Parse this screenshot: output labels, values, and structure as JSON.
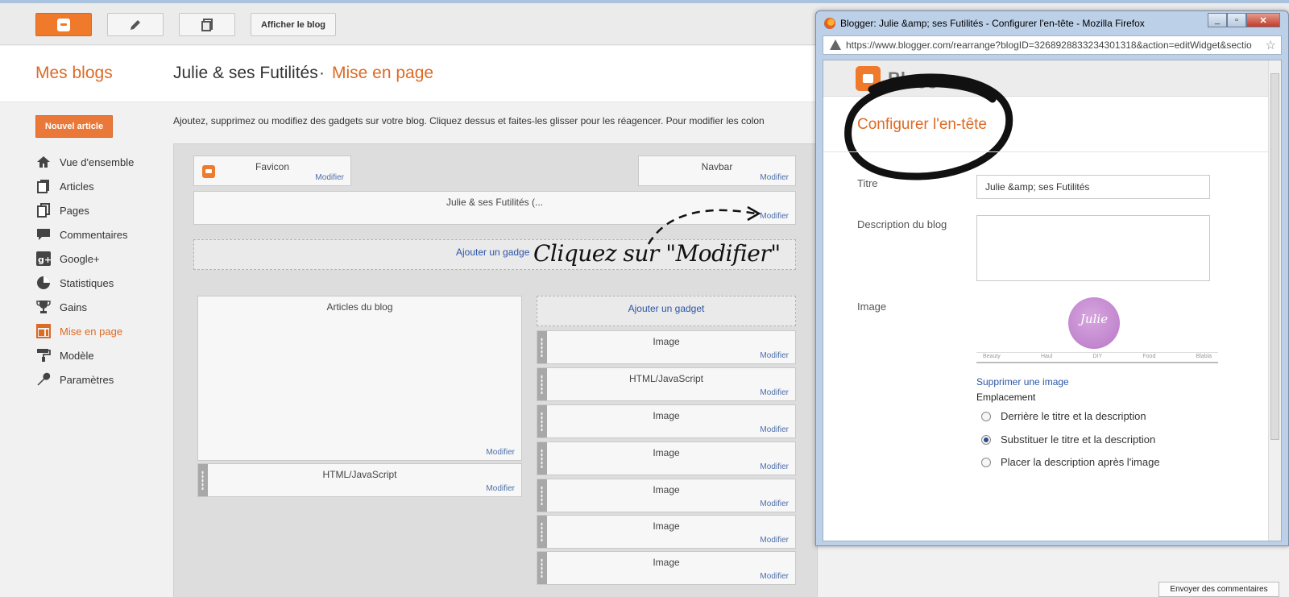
{
  "topbar": {
    "view_blog": "Afficher le blog"
  },
  "header": {
    "my_blogs": "Mes blogs",
    "blog_title": "Julie & ses Futilités",
    "separator": "·",
    "page": "Mise en page"
  },
  "sidebar": {
    "new_article": "Nouvel article",
    "items": [
      {
        "label": "Vue d'ensemble",
        "icon": "home-icon"
      },
      {
        "label": "Articles",
        "icon": "articles-icon"
      },
      {
        "label": "Pages",
        "icon": "pages-icon"
      },
      {
        "label": "Commentaires",
        "icon": "comments-icon"
      },
      {
        "label": "Google+",
        "icon": "googleplus-icon"
      },
      {
        "label": "Statistiques",
        "icon": "stats-icon"
      },
      {
        "label": "Gains",
        "icon": "trophy-icon"
      },
      {
        "label": "Mise en page",
        "icon": "layout-icon"
      },
      {
        "label": "Modèle",
        "icon": "paint-roller-icon"
      },
      {
        "label": "Paramètres",
        "icon": "wrench-icon"
      }
    ]
  },
  "main": {
    "description": "Ajoutez, supprimez ou modifiez des gadgets sur votre blog. Cliquez dessus et faites-les glisser pour les réagencer. Pour modifier les colon",
    "edit_label": "Modifier",
    "add_gadget": "Ajouter un gadget",
    "add_gadget_truncated": "Ajouter un gadge",
    "widgets": {
      "favicon": "Favicon",
      "navbar": "Navbar",
      "header": "Julie & ses Futilités (...",
      "blog_posts": "Articles du blog",
      "html_js": "HTML/JavaScript",
      "image": "Image"
    },
    "annotation": "Cliquez sur \"Modifier\""
  },
  "popup": {
    "window_title": "Blogger: Julie &amp; ses Futilités - Configurer l'en-tête - Mozilla Firefox",
    "url": "https://www.blogger.com/rearrange?blogID=3268928833234301318&action=editWidget&sectio",
    "brand": "Blogger",
    "heading": "Configurer l'en-tête",
    "title_label": "Titre",
    "title_value": "Julie &amp; ses Futilités",
    "desc_label": "Description du blog",
    "image_label": "Image",
    "image_caption": "Julie",
    "image_tags": [
      "Beauty",
      "Haul",
      "DIY",
      "Food",
      "Blabla"
    ],
    "remove_image": "Supprimer une image",
    "placement_label": "Emplacement",
    "options": [
      {
        "label": "Derrière le titre et la description",
        "selected": false
      },
      {
        "label": "Substituer le titre et la description",
        "selected": true
      },
      {
        "label": "Placer la description après l'image",
        "selected": false
      }
    ]
  },
  "feedback": "Envoyer des commentaires",
  "colors": {
    "accent": "#dd6a25",
    "link": "#2b55a6",
    "edit_link": "#4d6ea8"
  }
}
